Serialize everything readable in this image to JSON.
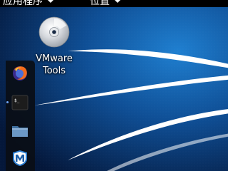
{
  "topbar": {
    "applications_label": "应用程序",
    "places_label": "位置"
  },
  "desktop": {
    "icons": [
      {
        "label_line1": "VMware",
        "label_line2": "Tools",
        "icon": "cd-disc-icon"
      }
    ]
  },
  "dock": {
    "items": [
      {
        "icon": "firefox-icon",
        "running": false
      },
      {
        "icon": "terminal-icon",
        "running": true
      },
      {
        "icon": "files-icon",
        "running": false
      },
      {
        "icon": "metasploit-icon",
        "running": false
      }
    ]
  },
  "theme": {
    "wallpaper_dark": "#06214a",
    "wallpaper_light": "#1a72c0",
    "dock_background": "#0a0e16",
    "topbar_background": "#000000"
  }
}
